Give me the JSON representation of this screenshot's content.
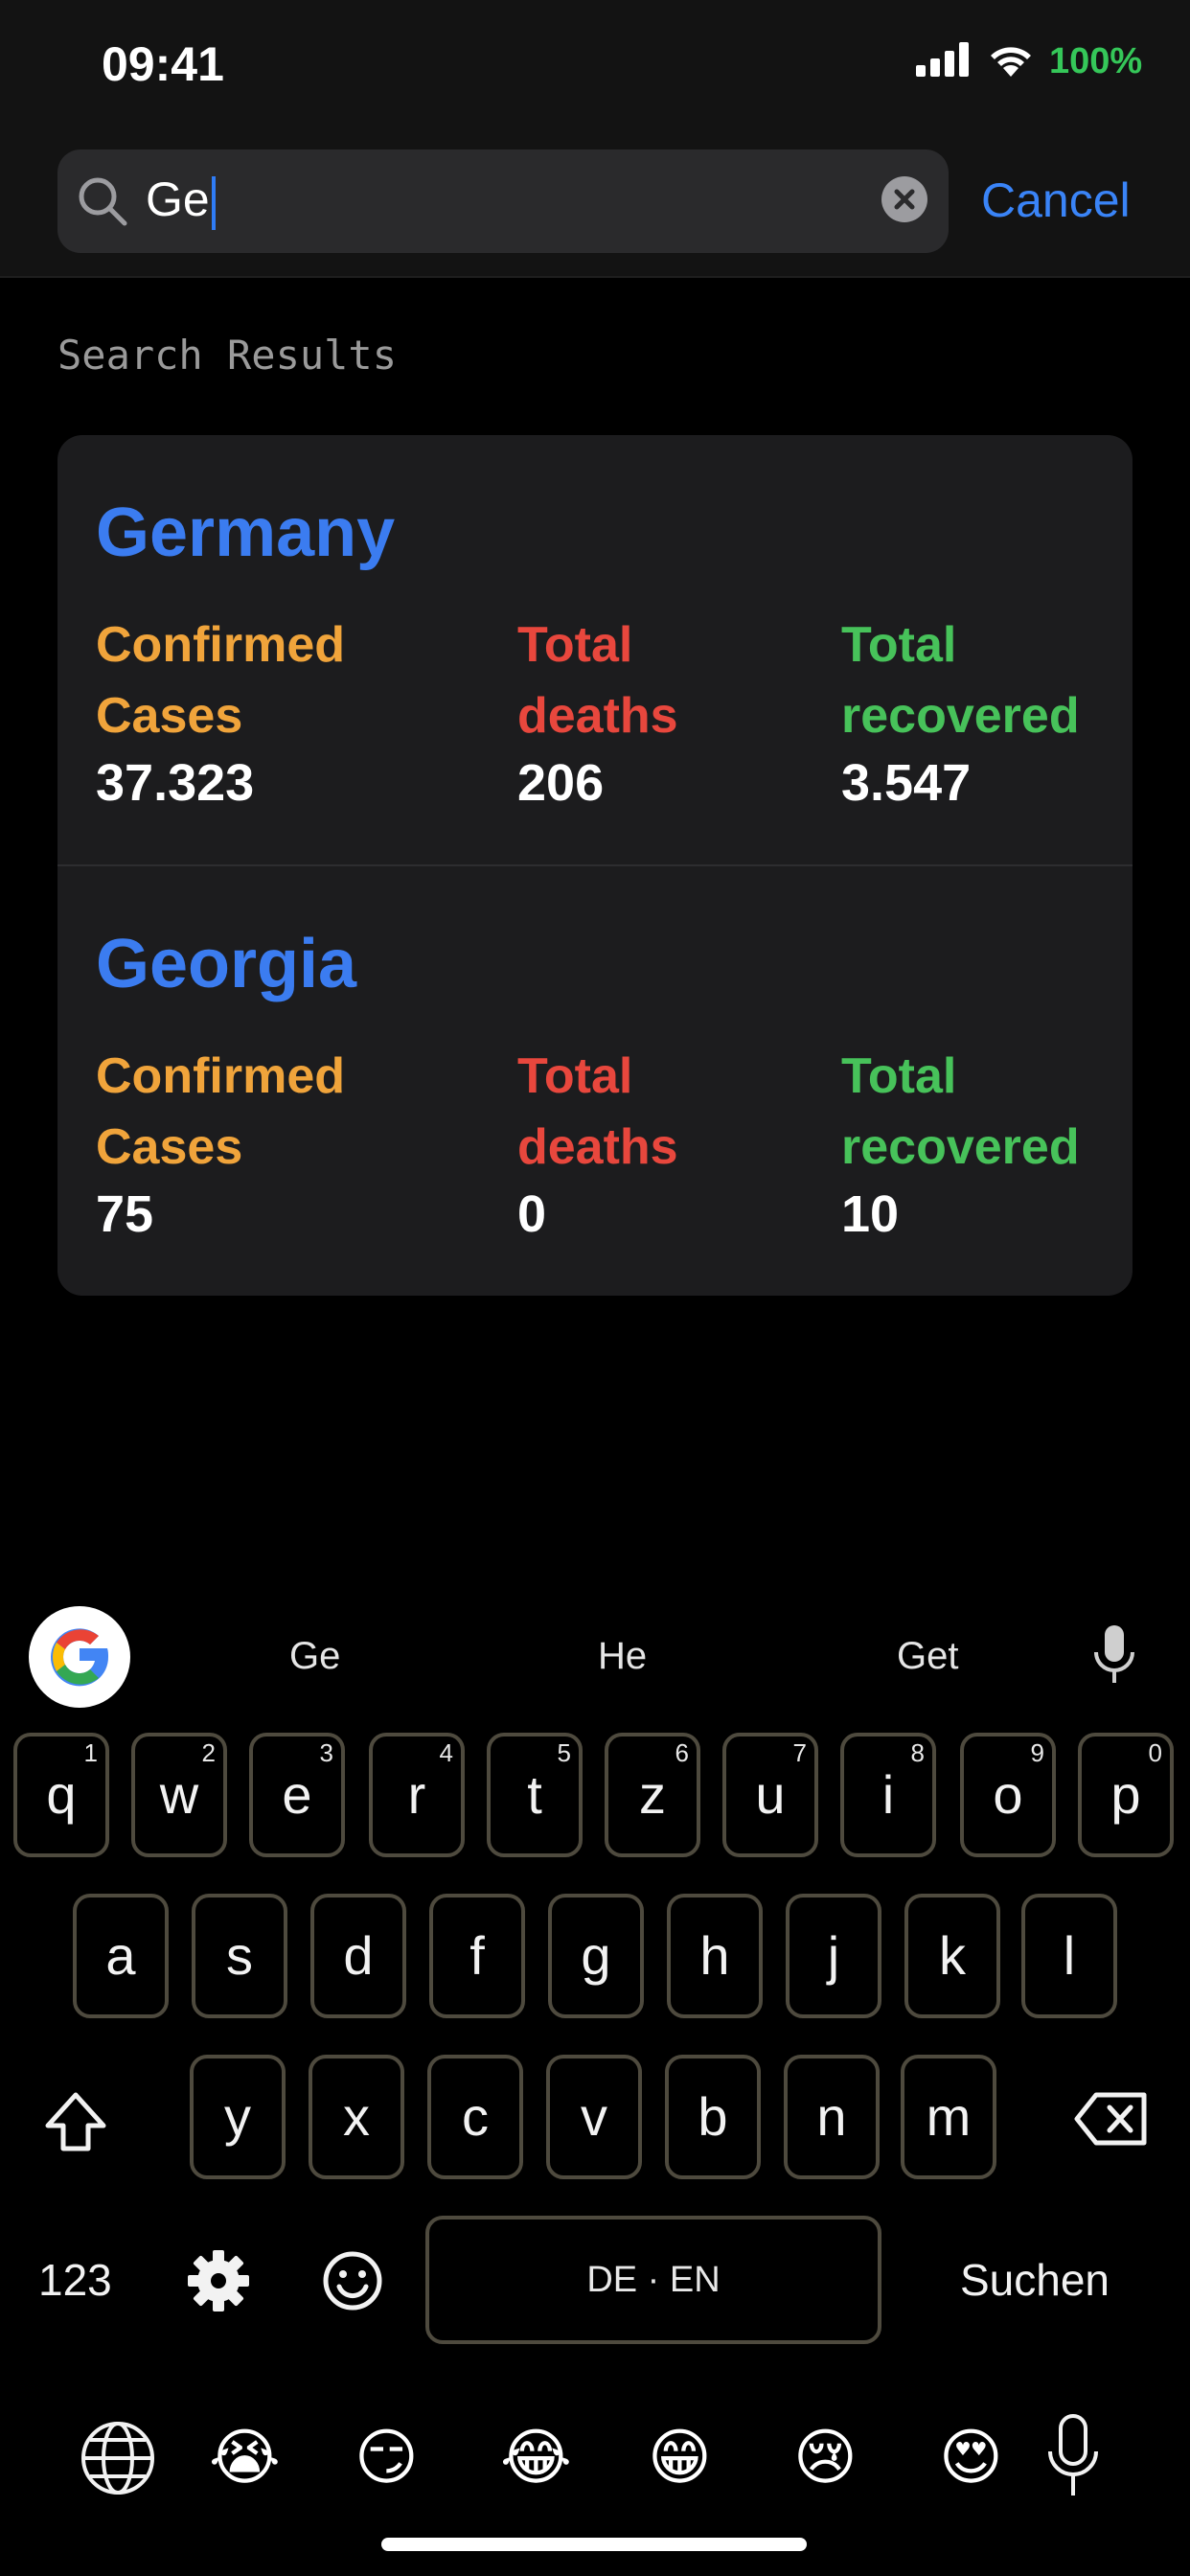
{
  "status_bar": {
    "time": "09:41",
    "battery": "100%"
  },
  "search": {
    "query": "Ge",
    "cancel_label": "Cancel"
  },
  "section_title": "Search Results",
  "results": [
    {
      "country": "Germany",
      "confirmed_label": "Confirmed Cases",
      "confirmed": "37.323",
      "deaths_label": "Total deaths",
      "deaths": "206",
      "recovered_label": "Total recovered",
      "recovered": "3.547"
    },
    {
      "country": "Georgia",
      "confirmed_label": "Confirmed Cases",
      "confirmed": "75",
      "deaths_label": "Total deaths",
      "deaths": "0",
      "recovered_label": "Total recovered",
      "recovered": "10"
    }
  ],
  "keyboard": {
    "suggestions": [
      "Ge",
      "He",
      "Get"
    ],
    "row1": [
      {
        "key": "q",
        "num": "1"
      },
      {
        "key": "w",
        "num": "2"
      },
      {
        "key": "e",
        "num": "3"
      },
      {
        "key": "r",
        "num": "4"
      },
      {
        "key": "t",
        "num": "5"
      },
      {
        "key": "z",
        "num": "6"
      },
      {
        "key": "u",
        "num": "7"
      },
      {
        "key": "i",
        "num": "8"
      },
      {
        "key": "o",
        "num": "9"
      },
      {
        "key": "p",
        "num": "0"
      }
    ],
    "row2": [
      "a",
      "s",
      "d",
      "f",
      "g",
      "h",
      "j",
      "k",
      "l"
    ],
    "row3": [
      "y",
      "x",
      "c",
      "v",
      "b",
      "n",
      "m"
    ],
    "numbers_label": "123",
    "space_label": "DE · EN",
    "action_label": "Suchen",
    "emojis": [
      "😭",
      "😏",
      "😂",
      "😁",
      "😢",
      "😍"
    ]
  },
  "colors": {
    "accent": "#3b7cf0",
    "confirmed": "#f0a43b",
    "deaths": "#e8473d",
    "recovered": "#47c25a"
  }
}
